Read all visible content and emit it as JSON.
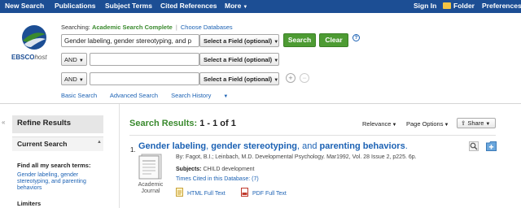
{
  "topnav": {
    "items": [
      "New Search",
      "Publications",
      "Subject Terms",
      "Cited References",
      "More"
    ],
    "right": [
      "Sign In",
      "Folder",
      "Preferences"
    ]
  },
  "logo": {
    "brand": "EBSCO",
    "suffix": "host"
  },
  "search": {
    "searching_label": "Searching:",
    "database": "Academic Search Complete",
    "separator": "|",
    "choose_databases": "Choose Databases",
    "rows": [
      {
        "value": "Gender labeling, gender stereotyping, and p",
        "field": "Select a Field (optional)"
      },
      {
        "bool": "AND",
        "value": "",
        "field": "Select a Field (optional)"
      },
      {
        "bool": "AND",
        "value": "",
        "field": "Select a Field (optional)"
      }
    ],
    "search_button": "Search",
    "clear_button": "Clear",
    "help": "?",
    "add_row": "+",
    "remove_row": "−",
    "links": [
      "Basic Search",
      "Advanced Search",
      "Search History"
    ]
  },
  "left_panel": {
    "collapse": "«",
    "refine_title": "Refine Results",
    "current_search_title": "Current Search",
    "find_all_label": "Find all my search terms:",
    "find_all_value": "Gender labeling, gender stereotyping, and parenting behaviors",
    "limiters_label": "Limiters"
  },
  "results": {
    "heading": "Search Results:",
    "count": "1 - 1 of 1",
    "sort": "Relevance",
    "page_options": "Page Options",
    "share": "Share",
    "items": [
      {
        "number": "1.",
        "title_parts": [
          {
            "text": "Gender labeling",
            "bold": true
          },
          {
            "text": ", ",
            "bold": false
          },
          {
            "text": "gender stereotyping",
            "bold": true
          },
          {
            "text": ", and ",
            "bold": false
          },
          {
            "text": "parenting behaviors",
            "bold": true
          },
          {
            "text": ".",
            "bold": false
          }
        ],
        "byline": "By: Fagot, B.I.; Leinbach, M.D. Developmental Psychology. Mar1992, Vol. 28 Issue 2, p225. 6p.",
        "subjects_label": "Subjects:",
        "subjects_value": "CHILD development",
        "cited": "Times Cited in this Database: (7)",
        "doc_type_line1": "Academic",
        "doc_type_line2": "Journal",
        "html_full_text": "HTML Full Text",
        "pdf_full_text": "PDF Full Text",
        "icons": [
          "magnifier-preview-icon",
          "add-to-folder-icon"
        ]
      }
    ]
  },
  "colors": {
    "nav_bg": "#1c4e94",
    "accent_green": "#4d9b33",
    "link_blue": "#1c62b4",
    "results_green": "#3a8a2e"
  }
}
